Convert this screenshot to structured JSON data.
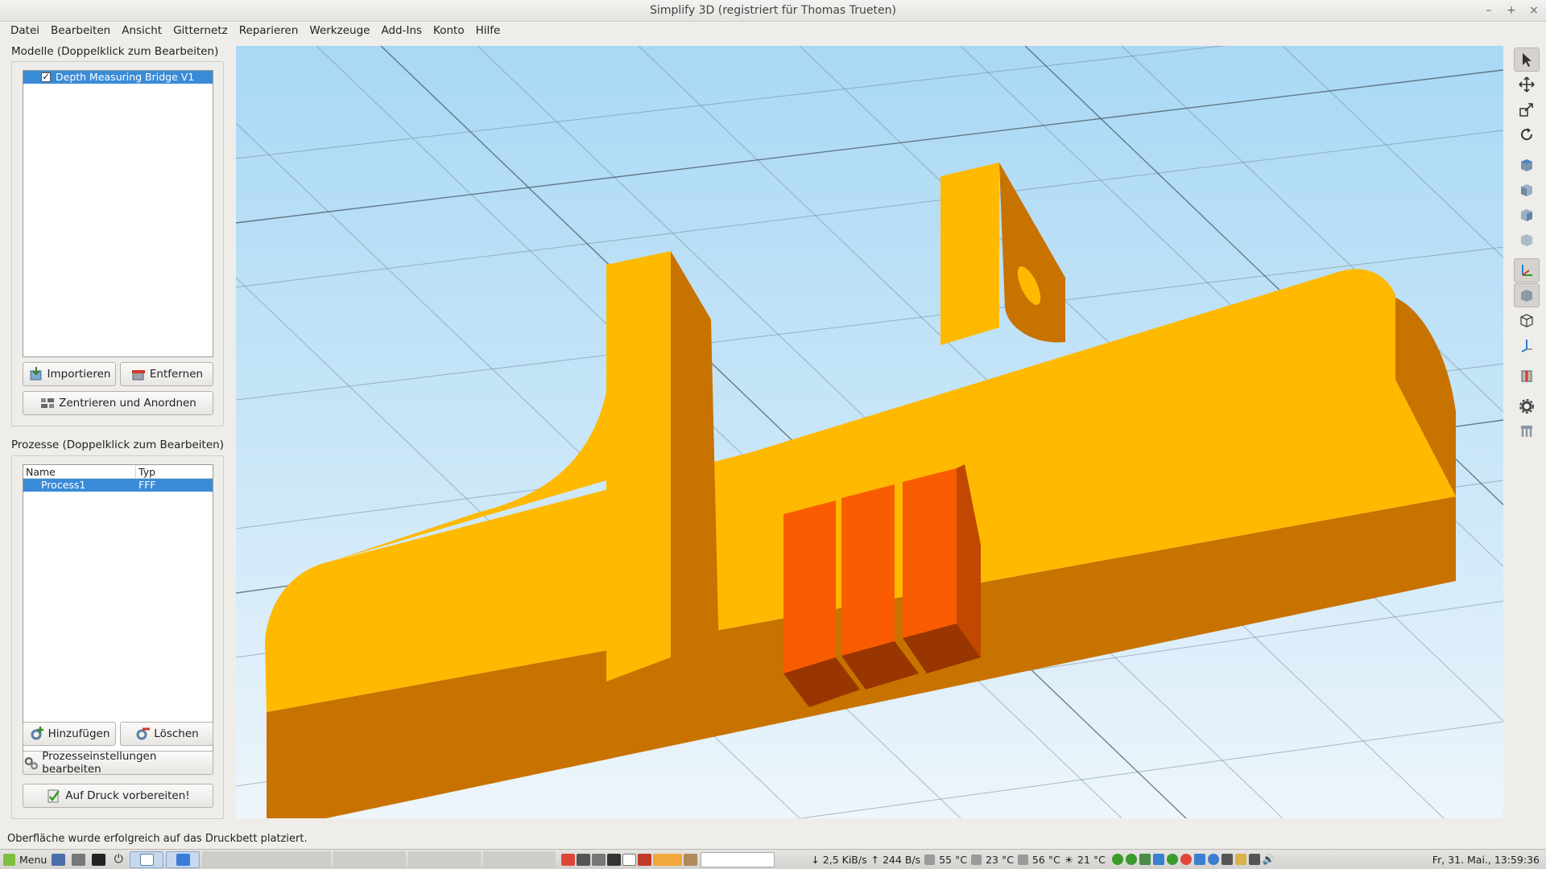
{
  "window": {
    "title": "Simplify 3D (registriert für Thomas Trueten)",
    "controls": [
      "–",
      "+",
      "×"
    ]
  },
  "menu": [
    "Datei",
    "Bearbeiten",
    "Ansicht",
    "Gitternetz",
    "Reparieren",
    "Werkzeuge",
    "Add-Ins",
    "Konto",
    "Hilfe"
  ],
  "models": {
    "title": "Modelle (Doppelklick zum Bearbeiten)",
    "items": [
      {
        "name": "Depth Measuring Bridge V1",
        "checked": true
      }
    ],
    "import_label": "Importieren",
    "remove_label": "Entfernen",
    "center_label": "Zentrieren und Anordnen"
  },
  "processes": {
    "title": "Prozesse (Doppelklick zum Bearbeiten)",
    "columns": [
      "Name",
      "Typ"
    ],
    "rows": [
      {
        "name": "Process1",
        "type": "FFF"
      }
    ],
    "add_label": "Hinzufügen",
    "delete_label": "Löschen",
    "edit_label": "Prozesseinstellungen bearbeiten",
    "prepare_label": "Auf Druck vorbereiten!"
  },
  "status": "Oberfläche wurde erfolgreich auf das Druckbett platziert.",
  "taskbar": {
    "menu_label": "Menu",
    "net_down": "2,5 KiB/s",
    "net_up": "244 B/s",
    "temp1": "55 °C",
    "temp2": "23 °C",
    "temp3": "56 °C",
    "weather": "21 °C",
    "clock": "Fr, 31. Mai., 13:59:36"
  },
  "colors": {
    "model_top": "#ffb900",
    "model_side": "#c87200",
    "highlight_top": "#f95c00",
    "highlight_side": "#983500",
    "selection": "#3a8bd7",
    "sky": "#a9d8f5"
  },
  "toolbar_icons": [
    "select-icon",
    "move-icon",
    "scale-icon",
    "rotate-icon",
    "view-top-icon",
    "view-front-icon",
    "view-side-icon",
    "view-iso-icon",
    "axes-icon",
    "solid-view-icon",
    "wireframe-icon",
    "axis-toggle-icon",
    "cross-section-icon",
    "settings-icon",
    "supports-icon"
  ]
}
